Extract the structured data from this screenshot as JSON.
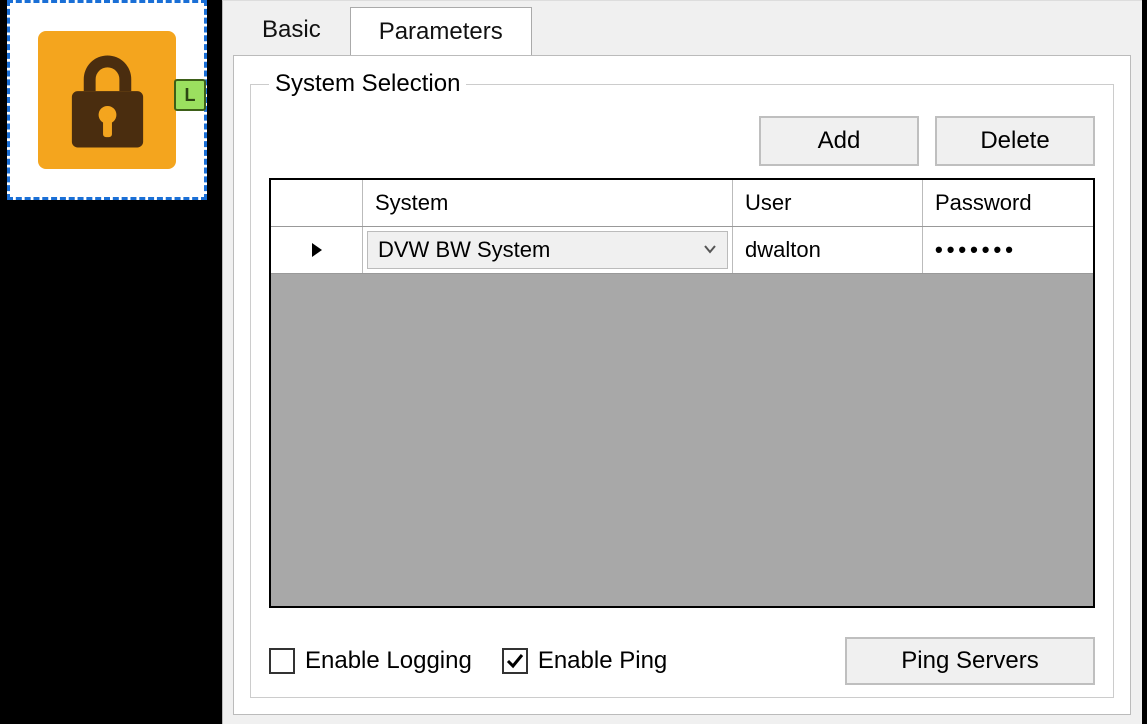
{
  "node": {
    "port_label": "L"
  },
  "tabs": {
    "basic": "Basic",
    "parameters": "Parameters"
  },
  "fieldset": {
    "legend": "System Selection"
  },
  "buttons": {
    "add": "Add",
    "delete": "Delete",
    "ping_servers": "Ping Servers"
  },
  "grid": {
    "headers": {
      "system": "System",
      "user": "User",
      "password": "Password"
    },
    "rows": [
      {
        "system": "DVW BW System",
        "user": "dwalton",
        "password": "•••••••"
      }
    ]
  },
  "checkboxes": {
    "enable_logging": {
      "label": "Enable Logging",
      "checked": false
    },
    "enable_ping": {
      "label": "Enable Ping",
      "checked": true
    }
  }
}
